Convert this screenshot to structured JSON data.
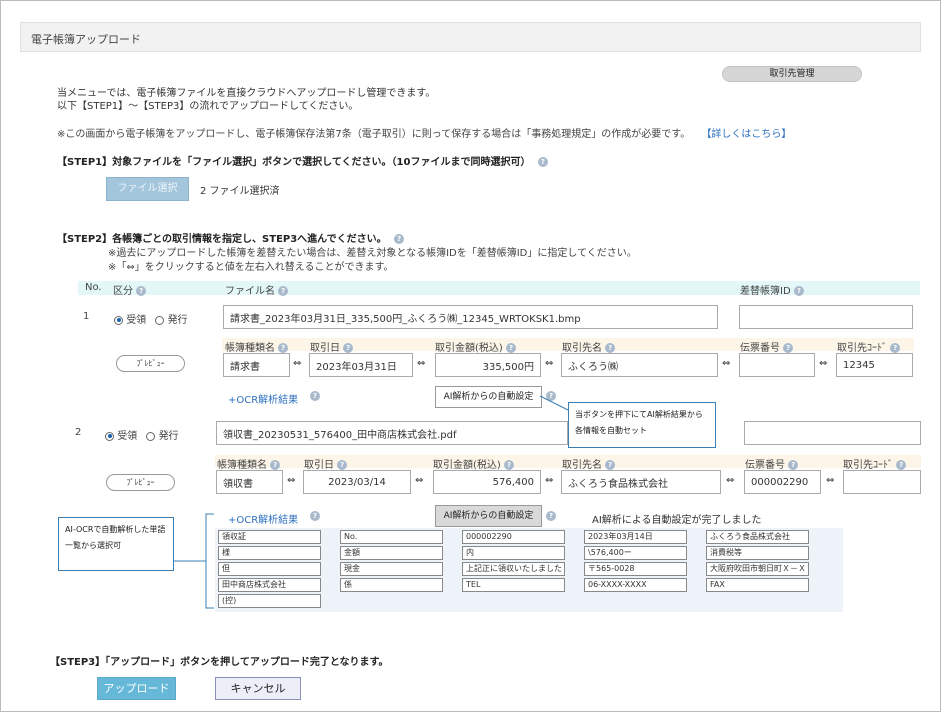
{
  "header": {
    "title": "電子帳簿アップロード"
  },
  "top_button": "取引先管理",
  "intro": {
    "line1": "当メニューでは、電子帳簿ファイルを直接クラウドへアップロードし管理できます。",
    "line2": "以下【STEP1】～【STEP3】の流れでアップロードしてください。",
    "notice": "※この画面から電子帳簿をアップロードし、電子帳簿保存法第7条（電子取引）に則って保存する場合は「事務処理規定」の作成が必要です。",
    "notice_link": "【詳しくはこちら】"
  },
  "step1": {
    "title": "【STEP1】対象ファイルを「ファイル選択」ボタンで選択してください。（10ファイルまで同時選択可）",
    "button": "ファイル選択",
    "status": "2 ファイル選択済"
  },
  "step2": {
    "title": "【STEP2】各帳簿ごとの取引情報を指定し、STEP3へ進んでください。",
    "note1": "※過去にアップロードした帳簿を差替えたい場合は、差替え対象となる帳簿IDを「差替帳簿ID」に指定してください。",
    "note2": "※「⇔」をクリックすると値を左右入れ替えることができます。",
    "headers": {
      "no": "No.",
      "kubun": "区分",
      "filename": "ファイル名",
      "replace_id": "差替帳簿ID"
    },
    "field_labels": {
      "doc_type": "帳簿種類名",
      "date": "取引日",
      "amount": "取引金額(税込)",
      "partner": "取引先名",
      "slip": "伝票番号",
      "partner_code": "取引先ｺｰﾄﾞ"
    },
    "radio_receive": "受領",
    "radio_issue": "発行",
    "preview_label": "ﾌﾟﾚﾋﾞｭｰ",
    "ocr_link": "+OCR解析結果",
    "ai_button": "AI解析からの自動設定",
    "arrow": "⇔",
    "rows": [
      {
        "no": "1",
        "filename": "請求書_2023年03月31日_335,500円_ふくろう㈱_12345_WRTOKSK1.bmp",
        "replace_id": "",
        "doc_type": "請求書",
        "date": "2023年03月31日",
        "amount": "335,500円",
        "partner": "ふくろう㈱",
        "slip": "",
        "partner_code": "12345"
      },
      {
        "no": "2",
        "filename": "領収書_20230531_576400_田中商店株式会社.pdf",
        "replace_id": "",
        "doc_type": "領収書",
        "date": "2023/03/14",
        "amount": "576,400",
        "partner": "ふくろう食品株式会社",
        "slip": "000002290",
        "partner_code": "",
        "ai_status": "AI解析による自動設定が完了しました"
      }
    ],
    "ocr_cells": [
      [
        "領収証",
        "No.",
        "000002290",
        "2023年03月14日",
        "ふくろう食品株式会社"
      ],
      [
        "様",
        "金額",
        "内",
        "\\576,400ー",
        "消費税等"
      ],
      [
        "但",
        "現金",
        "上記正に領収いたしました",
        "〒565-0028",
        "大阪府吹田市朝日町Ｘ－Ｘ"
      ],
      [
        "田中商店株式会社",
        "係",
        "TEL",
        "06-XXXX-XXXX",
        "FAX"
      ],
      [
        "(控)"
      ]
    ]
  },
  "callouts": {
    "ai": "当ボタンを押下にてAI解析結果から各情報を自動セット",
    "ocr": "AI-OCRで自動解析した単語一覧から選択可"
  },
  "step3": {
    "title": "【STEP3】「アップロード」ボタンを押してアップロード完了となります。",
    "upload": "アップロード",
    "cancel": "キャンセル"
  },
  "colors": {
    "accent": "#66b8d8",
    "link": "#2c6fbf",
    "callout_border": "#3a7fb5"
  },
  "icons": {
    "help": "question-circle-icon",
    "swap": "swap-arrows-icon"
  }
}
